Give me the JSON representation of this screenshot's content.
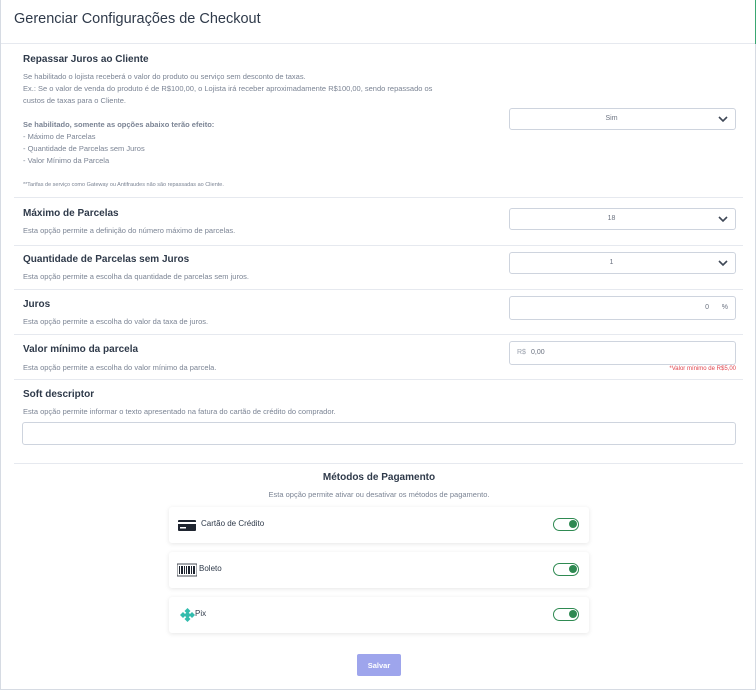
{
  "header": {
    "title": "Gerenciar Configurações de Checkout"
  },
  "sections": {
    "repassar": {
      "title": "Repassar Juros ao Cliente",
      "desc1": "Se habilitado o lojista receberá o valor do produto ou serviço sem desconto de taxas.",
      "desc2": "Ex.: Se o valor de venda do produto é de R$100,00, o Lojista irá receber aproximadamente R$100,00, sendo repassado os",
      "desc3": "custos de taxas para o Cliente.",
      "bold_note": "Se habilitado, somente as opções abaixo terão efeito:",
      "opt1": "- Máximo de Parcelas",
      "opt2": "- Quantidade de Parcelas sem Juros",
      "opt3": "- Valor Mínimo da Parcela",
      "footnote": "**Tarifas de serviço como Gateway ou Antifraudes não são repassadas ao Cliente.",
      "selected": "Sim"
    },
    "max_parcelas": {
      "title": "Máximo de Parcelas",
      "desc": "Esta opção permite a definição do número máximo de parcelas.",
      "selected": "18"
    },
    "parcelas_sem_juros": {
      "title": "Quantidade de Parcelas sem Juros",
      "desc": "Esta opção permite a escolha da quantidade de parcelas sem juros.",
      "selected": "1"
    },
    "juros": {
      "title": "Juros",
      "desc": "Esta opção permite a escolha do valor da taxa de juros.",
      "value": "0",
      "suffix": "%"
    },
    "valor_minimo": {
      "title": "Valor mínimo da parcela",
      "desc": "Esta opção permite a escolha do valor mínimo da parcela.",
      "prefix": "R$",
      "value": "0,00",
      "error": "*Valor mínimo de R$5,00"
    },
    "soft_descriptor": {
      "title": "Soft descriptor",
      "desc": "Esta opção permite informar o texto apresentado na fatura do cartão de crédito do comprador.",
      "value": ""
    }
  },
  "payments": {
    "title": "Métodos de Pagamento",
    "desc": "Esta opção permite ativar ou desativar os métodos de pagamento.",
    "methods": [
      {
        "label": "Cartão de Crédito",
        "icon": "credit-card-icon",
        "enabled": true
      },
      {
        "label": "Boleto",
        "icon": "barcode-icon",
        "enabled": true
      },
      {
        "label": "Pix",
        "icon": "pix-icon",
        "enabled": true
      }
    ]
  },
  "actions": {
    "save_label": "Salvar"
  },
  "colors": {
    "toggle_on": "#2f8a52",
    "save_button": "#9ea5ec",
    "error": "#e0444d",
    "accent_edge": "#3aa772"
  }
}
